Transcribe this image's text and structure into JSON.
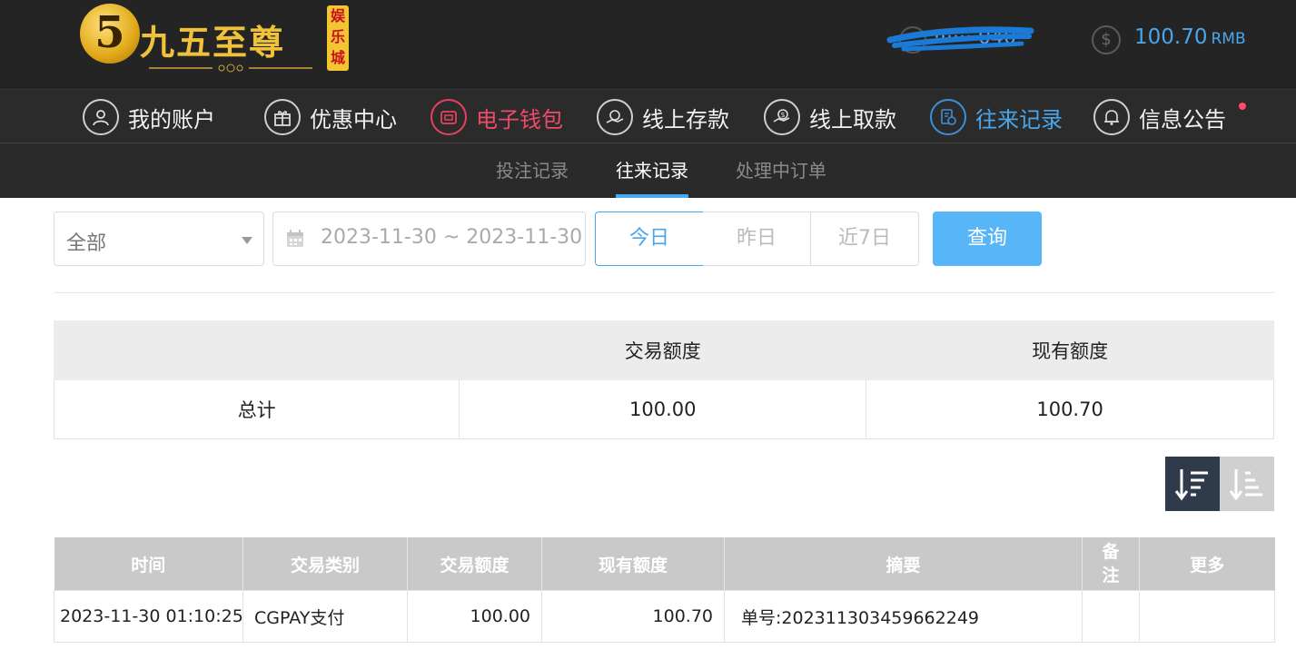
{
  "brand": {
    "badge": "5",
    "name": "九五至尊",
    "tag": "娱乐城"
  },
  "header": {
    "username": "·······040",
    "balance": "100.70",
    "currency": "RMB"
  },
  "nav": {
    "items": [
      {
        "label": "我的账户",
        "icon": "user-icon"
      },
      {
        "label": "优惠中心",
        "icon": "gift-icon"
      },
      {
        "label": "电子钱包",
        "icon": "wallet-icon"
      },
      {
        "label": "线上存款",
        "icon": "deposit-icon"
      },
      {
        "label": "线上取款",
        "icon": "withdraw-icon"
      },
      {
        "label": "往来记录",
        "icon": "records-icon"
      },
      {
        "label": "信息公告",
        "icon": "bell-icon"
      }
    ]
  },
  "subnav": {
    "items": [
      "投注记录",
      "往来记录",
      "处理中订单"
    ]
  },
  "filters": {
    "type_select": "全部",
    "date_range": "2023-11-30 ~ 2023-11-30",
    "quick_ranges": [
      "今日",
      "昨日",
      "近7日"
    ],
    "query_button": "查询"
  },
  "summary": {
    "headers": [
      "",
      "交易额度",
      "现有额度"
    ],
    "row_label": "总计",
    "trade_amount": "100.00",
    "current_amount": "100.70"
  },
  "records": {
    "headers": [
      "时间",
      "交易类别",
      "交易额度",
      "现有额度",
      "摘要",
      "备\n注",
      "更多"
    ],
    "rows": [
      {
        "time": "2023-11-30 01:10:25",
        "category": "CGPAY支付",
        "trade_amount": "100.00",
        "current_amount": "100.70",
        "summary": "单号:202311303459662249",
        "remark": "",
        "more": ""
      }
    ]
  },
  "colors": {
    "accent_blue": "#4aa6ec",
    "accent_red": "#ef4a6a",
    "header_bg": "#242424",
    "query_button_bg": "#56b6f7"
  }
}
